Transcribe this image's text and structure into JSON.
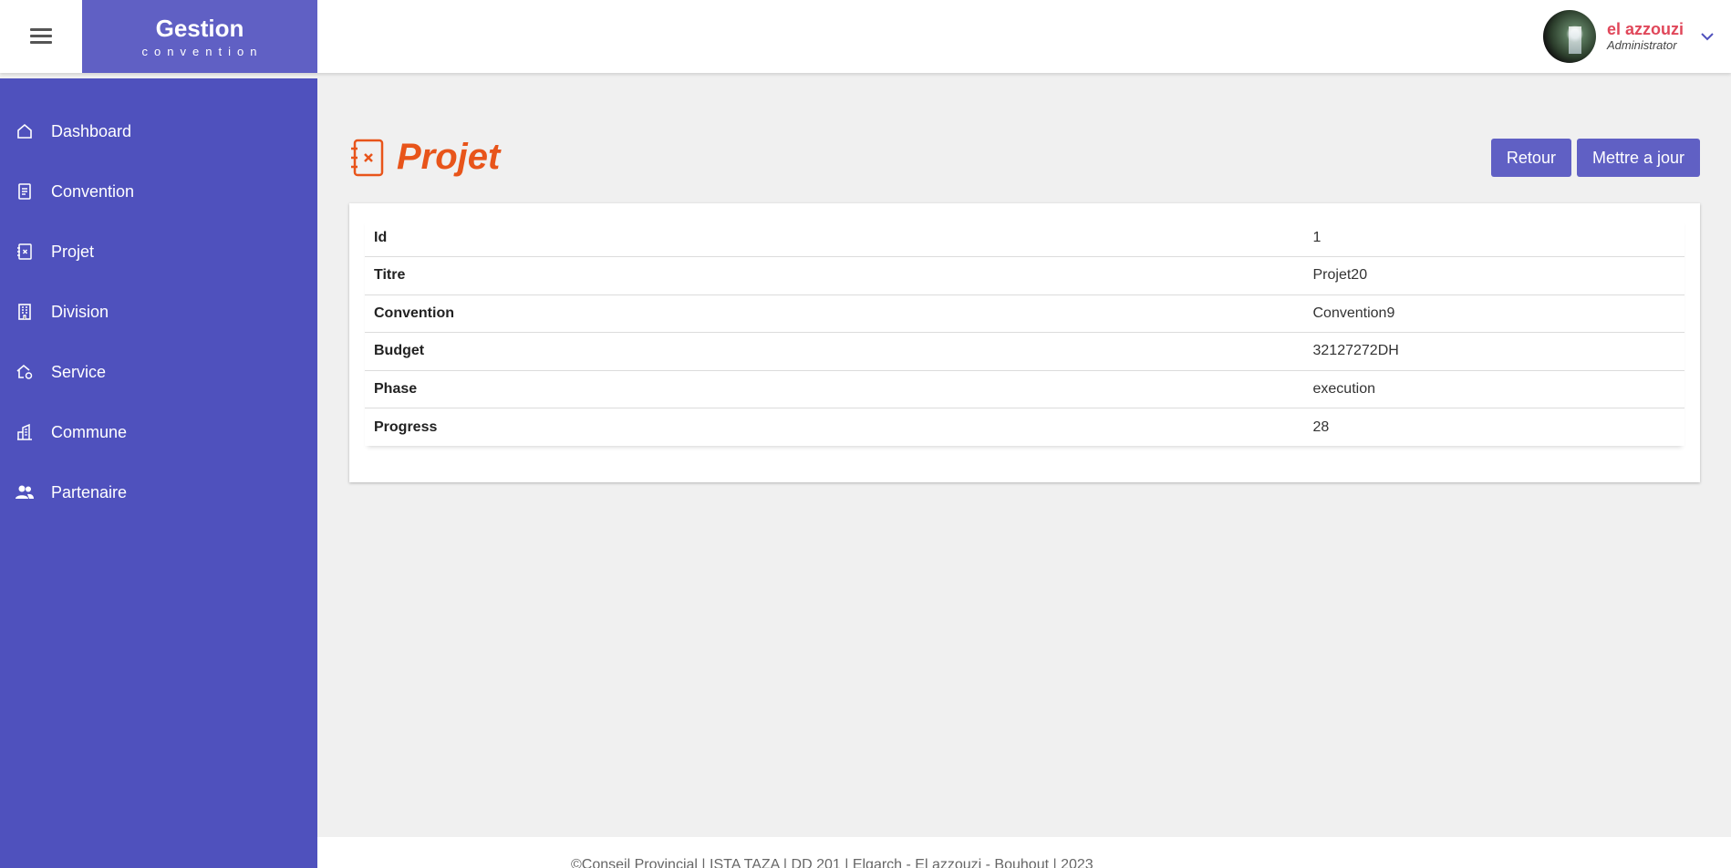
{
  "brand": {
    "title": "Gestion",
    "subtitle": "convention"
  },
  "user": {
    "name": "el azzouzi",
    "role": "Administrator"
  },
  "sidebar": {
    "items": [
      {
        "label": "Dashboard",
        "icon": "home-icon"
      },
      {
        "label": "Convention",
        "icon": "document-icon"
      },
      {
        "label": "Projet",
        "icon": "project-icon"
      },
      {
        "label": "Division",
        "icon": "building-icon"
      },
      {
        "label": "Service",
        "icon": "house-gear-icon"
      },
      {
        "label": "Commune",
        "icon": "city-icon"
      },
      {
        "label": "Partenaire",
        "icon": "people-icon"
      }
    ]
  },
  "page": {
    "title": "Projet",
    "back_label": "Retour",
    "update_label": "Mettre a jour"
  },
  "details": [
    {
      "key": "Id",
      "value": "1"
    },
    {
      "key": "Titre",
      "value": "Projet20"
    },
    {
      "key": "Convention",
      "value": "Convention9"
    },
    {
      "key": "Budget",
      "value": "32127272DH"
    },
    {
      "key": "Phase",
      "value": "execution"
    },
    {
      "key": "Progress",
      "value": "28"
    }
  ],
  "footer": {
    "text": "©Conseil Provincial | ISTA TAZA | DD 201 | Elgarch - El azzouzi - Bouhout | 2023"
  },
  "colors": {
    "sidebar": "#4f51bd",
    "brand": "#6060c4",
    "accent": "#e8541a",
    "user_name": "#e0475a"
  }
}
